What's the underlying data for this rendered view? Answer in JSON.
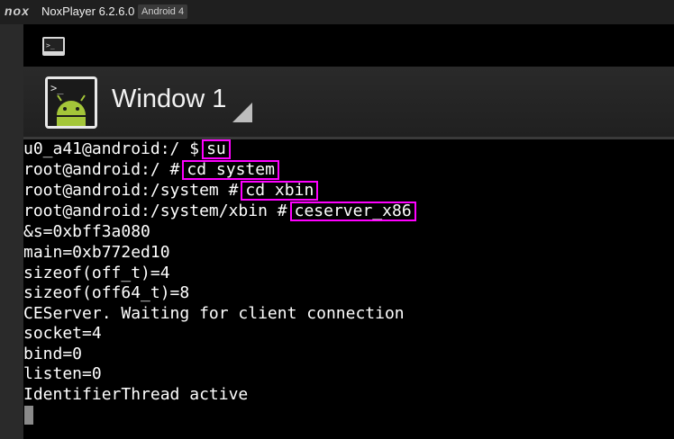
{
  "titlebar": {
    "logo": "nox",
    "title": "NoxPlayer 6.2.6.0",
    "badge": "Android 4"
  },
  "status_bar": {
    "icon": "terminal-notification-icon"
  },
  "action_bar": {
    "icon": "android-terminal-icon",
    "title": "Window 1",
    "dropdown_icon": "dropdown-triangle-icon"
  },
  "terminal": {
    "lines": [
      {
        "prompt": "u0_a41@android:/ $",
        "command": "su"
      },
      {
        "prompt": "root@android:/ #",
        "command": "cd system"
      },
      {
        "prompt": "root@android:/system #",
        "command": "cd xbin"
      },
      {
        "prompt": "root@android:/system/xbin #",
        "command": "ceserver_x86"
      },
      {
        "text": "&s=0xbff3a080"
      },
      {
        "text": "main=0xb772ed10"
      },
      {
        "text": "sizeof(off_t)=4"
      },
      {
        "text": "sizeof(off64_t)=8"
      },
      {
        "text": "CEServer. Waiting for client connection"
      },
      {
        "text": "socket=4"
      },
      {
        "text": "bind=0"
      },
      {
        "text": "listen=0"
      },
      {
        "text": "IdentifierThread active"
      }
    ],
    "highlight_color": "#ff00ff"
  },
  "colors": {
    "terminal_bg": "#000000",
    "terminal_fg": "#ffffff",
    "titlebar_bg": "#1f1f1f",
    "android_green": "#a4c639"
  }
}
